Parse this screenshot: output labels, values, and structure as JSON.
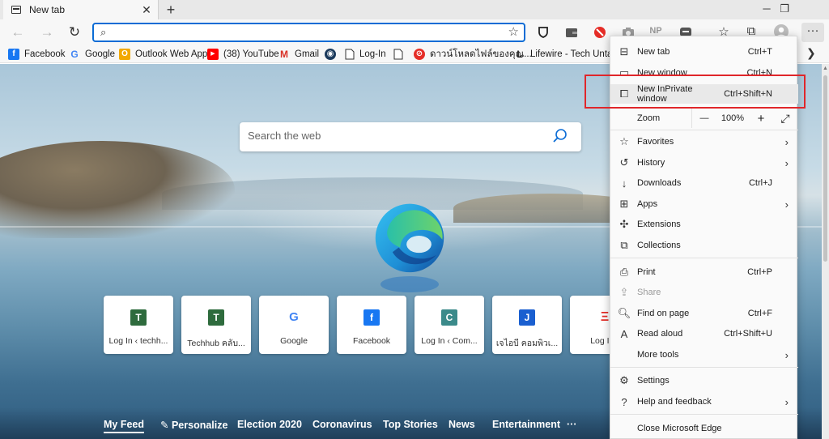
{
  "tab": {
    "title": "New tab",
    "close": "✕"
  },
  "window_controls": {
    "new_tab": "+",
    "minimize": "─",
    "restore": "❐"
  },
  "address_bar": {
    "value": "",
    "placeholder": ""
  },
  "favorites": [
    {
      "label": "Facebook",
      "icon": "facebook-icon",
      "color": "#1877f2",
      "glyph": "f"
    },
    {
      "label": "Google",
      "icon": "google-icon",
      "color": "#ffffff",
      "glyph": "G"
    },
    {
      "label": "Outlook Web App",
      "icon": "outlook-icon",
      "color": "#f2a900",
      "glyph": "O"
    },
    {
      "label": "(38) YouTube",
      "icon": "youtube-icon",
      "color": "#ff0000",
      "glyph": "▶"
    },
    {
      "label": "Gmail",
      "icon": "gmail-icon",
      "color": "#ffffff",
      "glyph": "M"
    },
    {
      "label": "",
      "icon": "steam-icon",
      "color": "#1b3a5c",
      "glyph": "◉"
    },
    {
      "label": "Log-In",
      "icon": "page-icon",
      "color": "#ffffff",
      "glyph": ""
    },
    {
      "label": "",
      "icon": "page-icon",
      "color": "#ffffff",
      "glyph": ""
    },
    {
      "label": "ดาวน์โหลดไฟล์ของคุณ...",
      "icon": "download-site-icon",
      "color": "#e52d27",
      "glyph": "⊘"
    },
    {
      "label": "Lifewire - Tech Unta...",
      "icon": "lifewire-icon",
      "color": "#ffffff",
      "glyph": "L"
    }
  ],
  "search": {
    "placeholder": "Search the web"
  },
  "tiles": [
    {
      "label": "Log In ‹ techh...",
      "glyph": "T",
      "color": "#2e6b3d"
    },
    {
      "label": "Techhub คลับ...",
      "glyph": "T",
      "color": "#2e6b3d"
    },
    {
      "label": "Google",
      "glyph": "G",
      "color": "#ffffff"
    },
    {
      "label": "Facebook",
      "glyph": "f",
      "color": "#1877f2"
    },
    {
      "label": "Log In ‹ Com...",
      "glyph": "C",
      "color": "#3b8a8a"
    },
    {
      "label": "เจไอบี คอมพิวเ...",
      "glyph": "J",
      "color": "#1a5fd0"
    },
    {
      "label": "Log In ‹",
      "glyph": "Ξ",
      "color": "#e52d27"
    }
  ],
  "feed_nav": [
    "My Feed",
    "Personalize",
    "Election 2020",
    "Coronavirus",
    "Top Stories",
    "News",
    "Entertainment",
    "···"
  ],
  "menu": {
    "new_tab": {
      "label": "New tab",
      "shortcut": "Ctrl+T"
    },
    "new_window": {
      "label": "New window",
      "shortcut": "Ctrl+N"
    },
    "inprivate": {
      "label": "New InPrivate window",
      "shortcut": "Ctrl+Shift+N"
    },
    "zoom": {
      "label": "Zoom",
      "minus": "—",
      "value": "100%",
      "plus": "+",
      "fullscreen": "⤢"
    },
    "favorites": {
      "label": "Favorites"
    },
    "history": {
      "label": "History"
    },
    "downloads": {
      "label": "Downloads",
      "shortcut": "Ctrl+J"
    },
    "apps": {
      "label": "Apps"
    },
    "extensions": {
      "label": "Extensions"
    },
    "collections": {
      "label": "Collections"
    },
    "print": {
      "label": "Print",
      "shortcut": "Ctrl+P"
    },
    "share": {
      "label": "Share"
    },
    "find": {
      "label": "Find on page",
      "shortcut": "Ctrl+F"
    },
    "read_aloud": {
      "label": "Read aloud",
      "shortcut": "Ctrl+Shift+U"
    },
    "more_tools": {
      "label": "More tools"
    },
    "settings": {
      "label": "Settings"
    },
    "help": {
      "label": "Help and feedback"
    },
    "close": {
      "label": "Close Microsoft Edge"
    }
  },
  "extensions_bar": {
    "np_label": "NP"
  },
  "colors": {
    "accent": "#0b6cd5",
    "highlight_box": "#e0262a",
    "menu_bg": "#fafafa"
  }
}
